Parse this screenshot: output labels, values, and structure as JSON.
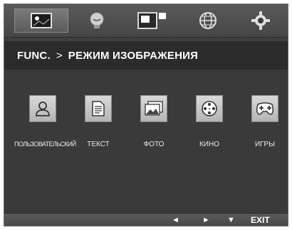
{
  "tabs": [
    {
      "icon": "picture-icon",
      "active": true
    },
    {
      "icon": "lightbulb-icon",
      "active": false
    },
    {
      "icon": "windows-icon",
      "active": false
    },
    {
      "icon": "globe-icon",
      "active": false
    },
    {
      "icon": "gear-icon",
      "active": false
    }
  ],
  "title": {
    "section": "FUNC.",
    "separator": ">",
    "page": "РЕЖИМ ИЗОБРАЖЕНИЯ"
  },
  "modes": [
    {
      "label": "ПОЛЬЗОВАТЕЛЬСКИЙ",
      "icon": "user-icon"
    },
    {
      "label": "ТЕКСТ",
      "icon": "document-icon"
    },
    {
      "label": "ФОТО",
      "icon": "photo-icon"
    },
    {
      "label": "КИНО",
      "icon": "film-reel-icon"
    },
    {
      "label": "ИГРЫ",
      "icon": "gamepad-icon"
    }
  ],
  "nav": {
    "left": "◄",
    "right": "►",
    "down": "▼",
    "exit": "EXIT"
  }
}
